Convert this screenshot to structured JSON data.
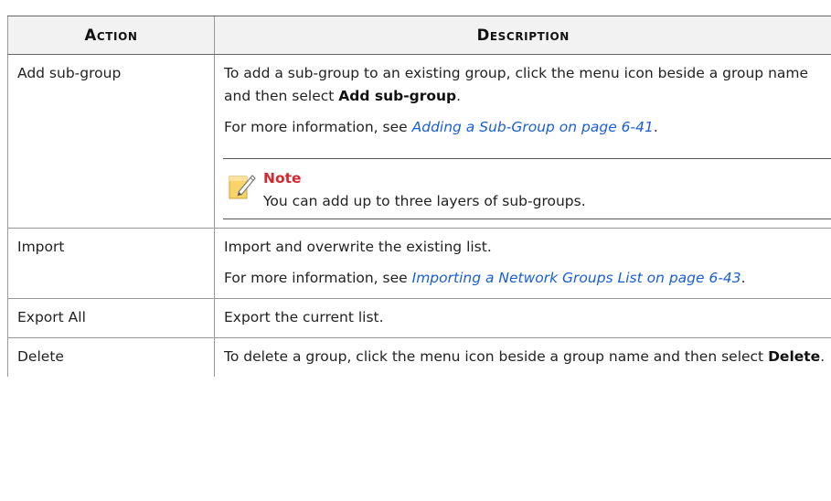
{
  "table": {
    "headers": {
      "action": "Action",
      "description": "Description"
    },
    "rows": [
      {
        "action": "Add sub-group",
        "desc_p1_pre": "To add a sub-group to an existing group, click the menu icon beside a group name and then select ",
        "desc_p1_bold": "Add sub-group",
        "desc_p1_post": ".",
        "desc_p2_pre": "For more information, see ",
        "desc_p2_link": "Adding a Sub-Group on page 6-41",
        "desc_p2_post": ".",
        "note": {
          "icon": "note-pencil-icon",
          "title": "Note",
          "text": "You can add up to three layers of sub-groups."
        }
      },
      {
        "action": "Import",
        "desc_p1": "Import and overwrite the existing list.",
        "desc_p2_pre": "For more information, see ",
        "desc_p2_link": "Importing a Network Groups List on page 6-43",
        "desc_p2_post": "."
      },
      {
        "action": "Export All",
        "desc_p1": "Export the current list."
      },
      {
        "action": "Delete",
        "desc_p1_pre": "To delete a group, click the menu icon beside a group name and then select ",
        "desc_p1_bold": "Delete",
        "desc_p1_post": "."
      }
    ]
  },
  "colors": {
    "link": "#1a5fd1",
    "note_title": "#d6282f",
    "header_bg": "#f2f2f2"
  }
}
